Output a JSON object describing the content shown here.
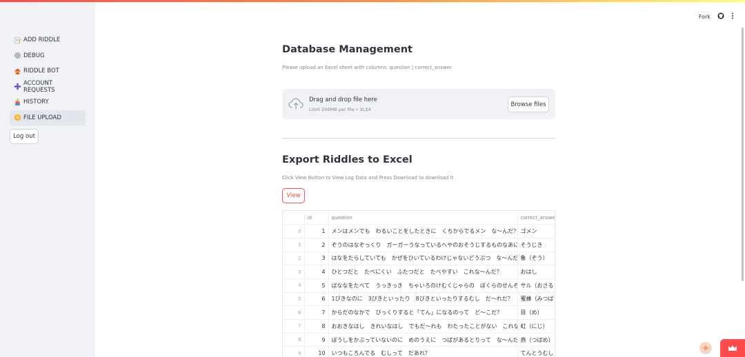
{
  "sidebar": {
    "items": [
      {
        "label": "ADD RIDDLE",
        "icon": "memo-icon"
      },
      {
        "label": "DEBUG",
        "icon": "gear-icon"
      },
      {
        "label": "RIDDLE BOT",
        "icon": "house-icon"
      },
      {
        "label": "ACCOUNT REQUESTS",
        "icon": "plus-icon"
      },
      {
        "label": "HISTORY",
        "icon": "history-icon"
      },
      {
        "label": "FILE UPLOAD",
        "icon": "upload-icon",
        "active": true
      }
    ],
    "logout_label": "Log out"
  },
  "header": {
    "fork_label": "Fork",
    "icons": [
      "github-icon",
      "more-vertical-icon"
    ]
  },
  "page": {
    "title": "Database Management",
    "subtitle": "Please upload an Excel sheet with columns: question | correct_answer"
  },
  "uploader": {
    "title": "Drag and drop file here",
    "limit": "Limit 200MB per file • XLSX",
    "browse_label": "Browse files"
  },
  "export": {
    "title": "Export Riddles to Excel",
    "caption": "Click View Button to View Log Data and Press Download to download it",
    "view_label": "View"
  },
  "table": {
    "columns": [
      "",
      "id",
      "question",
      "correct_answer"
    ],
    "rows": [
      {
        "index": "0",
        "id": "1",
        "question": "メンはメンでも　わるいことをしたときに　くちからでるメン　な〜んだ？",
        "answer": "ゴメン"
      },
      {
        "index": "1",
        "id": "2",
        "question": "ぞうのはなぞっくり　ガーガーうなっているへやのおそうじするものなあに？",
        "answer": "そうじき"
      },
      {
        "index": "2",
        "id": "3",
        "question": "はなをたらしていても　かぜをひいているわけじゃないどうぶつ　な〜んだ？",
        "answer": "象（ぞう）"
      },
      {
        "index": "3",
        "id": "4",
        "question": "ひとつだと　たべにくい　ふたつだと　たべやすい　これな〜んだ？",
        "answer": "おはし"
      },
      {
        "index": "4",
        "id": "5",
        "question": "ばななをたべて　うっきっき　ちゃいろのけむくじゃらの　ぼくらのせんぞは",
        "answer": "サル（おさるさ"
      },
      {
        "index": "5",
        "id": "6",
        "question": "1ぴきなのに　3びきといったり　8びきといったりするむし　だ〜れだ？",
        "answer": "蜜蜂（みつばち"
      },
      {
        "index": "6",
        "id": "7",
        "question": "からだのなかで　びっくりすると「てん」になるのって　ど〜こだ？",
        "answer": "目（め）"
      },
      {
        "index": "7",
        "id": "8",
        "question": "おおきなはし　きれいなはし　でもだ〜れも　わたったことがない　これな〜",
        "answer": "虹（にじ）"
      },
      {
        "index": "8",
        "id": "9",
        "question": "ぼうしをかぶっていないのに　めのうえに　つばがあるとりって　な〜んだ？",
        "answer": "燕（つばめ）"
      },
      {
        "index": "9",
        "id": "10",
        "question": "いつもころんでる　むしって　だあれ？",
        "answer": "てんとうむし"
      }
    ]
  },
  "colors": {
    "primary": "#ff4b4b",
    "sidebar_bg": "#f0f2f6",
    "text": "#31333f",
    "muted": "#808495"
  }
}
